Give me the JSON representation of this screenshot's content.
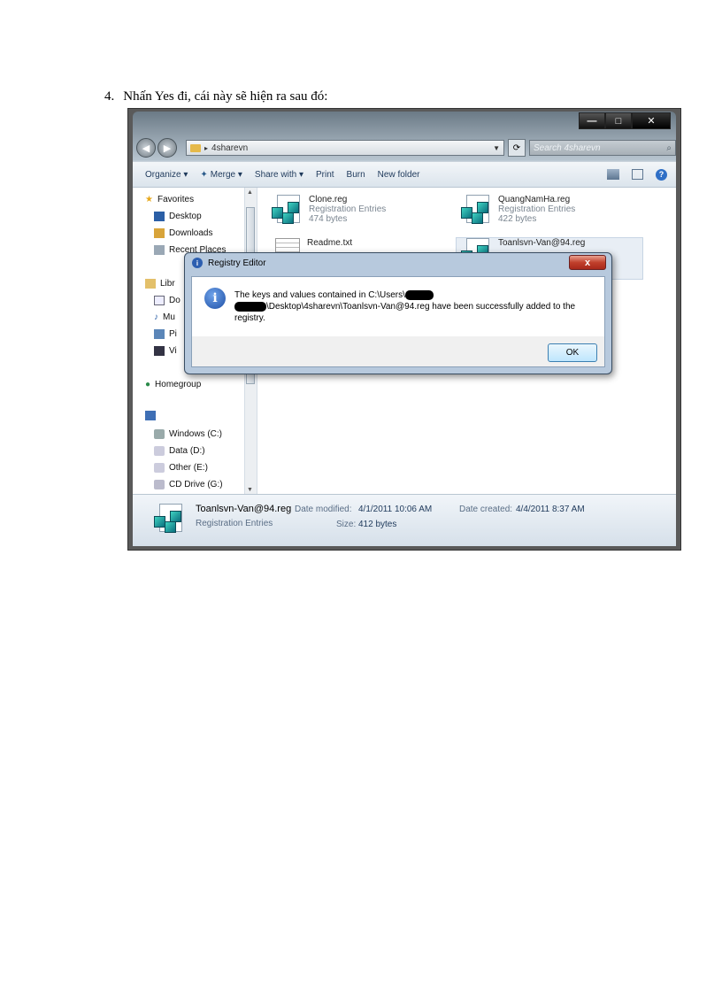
{
  "document": {
    "step_number": "4.",
    "step_text": "Nhấn Yes đi, cái này sẽ hiện ra sau đó:"
  },
  "explorer": {
    "address_path": "4sharevn",
    "search_placeholder": "Search 4sharevn",
    "toolbar": {
      "organize": "Organize ▾",
      "merge": "Merge ▾",
      "share_with": "Share with ▾",
      "print": "Print",
      "burn": "Burn",
      "new_folder": "New folder"
    },
    "nav": {
      "favorites": "Favorites",
      "desktop": "Desktop",
      "downloads": "Downloads",
      "recent_places": "Recent Places",
      "libraries": "Libr",
      "lib_docs": "Do",
      "lib_music": "Mu",
      "lib_pictures": "Pi",
      "lib_videos": "Vi",
      "homegroup": "Homegroup",
      "windows_c": "Windows (C:)",
      "data_d": "Data (D:)",
      "other_e": "Other (E:)",
      "cd_drive_g": "CD Drive (G:)"
    },
    "files": [
      {
        "name": "Clone.reg",
        "type": "Registration Entries",
        "size": "474 bytes"
      },
      {
        "name": "QuangNamHa.reg",
        "type": "Registration Entries",
        "size": "422 bytes"
      },
      {
        "name": "Readme.txt",
        "type": "",
        "size": ""
      },
      {
        "name": "Toanlsvn-Van@94.reg",
        "type": "",
        "size": ""
      }
    ],
    "details": {
      "name": "Toanlsvn-Van@94.reg",
      "type": "Registration Entries",
      "date_modified_label": "Date modified:",
      "date_modified": "4/1/2011 10:06 AM",
      "date_created_label": "Date created:",
      "date_created": "4/4/2011 8:37 AM",
      "size_label": "Size:",
      "size": "412 bytes"
    }
  },
  "dialog": {
    "title": "Registry Editor",
    "message_part1": "The keys and values contained in C:\\Users\\",
    "message_part2": "\\Desktop\\4sharevn\\Toanlsvn-Van@94.reg have been successfully added to the registry.",
    "ok_label": "OK",
    "close_glyph": "x"
  }
}
